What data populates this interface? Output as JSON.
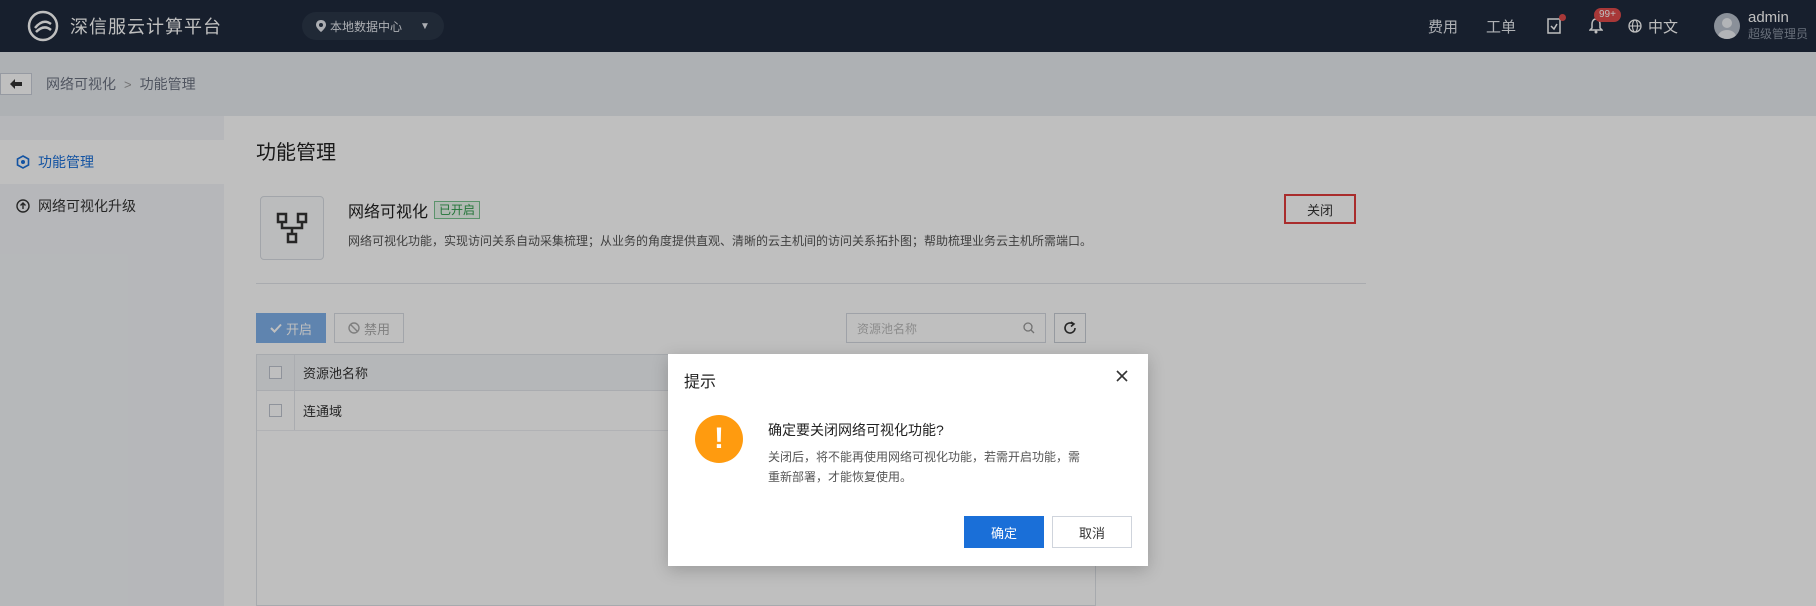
{
  "header": {
    "brand": "深信服云计算平台",
    "datacenter": "本地数据中心",
    "links": {
      "billing": "费用",
      "tickets": "工单"
    },
    "notification_badge": "99+",
    "language": "中文",
    "user": {
      "name": "admin",
      "role": "超级管理员"
    },
    "colors": {
      "bg": "#1f2a3d",
      "badge": "#e14b4b"
    }
  },
  "breadcrumb": {
    "items": [
      "网络可视化",
      "功能管理"
    ],
    "separator": ">"
  },
  "sidebar": {
    "items": [
      {
        "label": "功能管理",
        "icon": "hexagon-icon",
        "active": true
      },
      {
        "label": "网络可视化升级",
        "icon": "upgrade-circle-icon",
        "active": false
      }
    ]
  },
  "main": {
    "title": "功能管理",
    "feature": {
      "name": "网络可视化",
      "status": "已开启",
      "description": "网络可视化功能，实现访问关系自动采集梳理；从业务的角度提供直观、清晰的云主机间的访问关系拓扑图；帮助梳理业务云主机所需端口。",
      "close_label": "关闭"
    },
    "toolbar": {
      "open_label": "开启",
      "disable_label": "禁用",
      "search_placeholder": "资源池名称"
    },
    "table": {
      "columns": [
        "资源池名称"
      ],
      "rows": [
        [
          "连通域"
        ]
      ]
    }
  },
  "dialog": {
    "title": "提示",
    "heading": "确定要关闭网络可视化功能?",
    "body": "关闭后，将不能再使用网络可视化功能，若需开启功能，需重新部署，才能恢复使用。",
    "confirm_label": "确定",
    "cancel_label": "取消",
    "colors": {
      "warning": "#ff9b0f",
      "primary": "#1a6fd8"
    }
  }
}
